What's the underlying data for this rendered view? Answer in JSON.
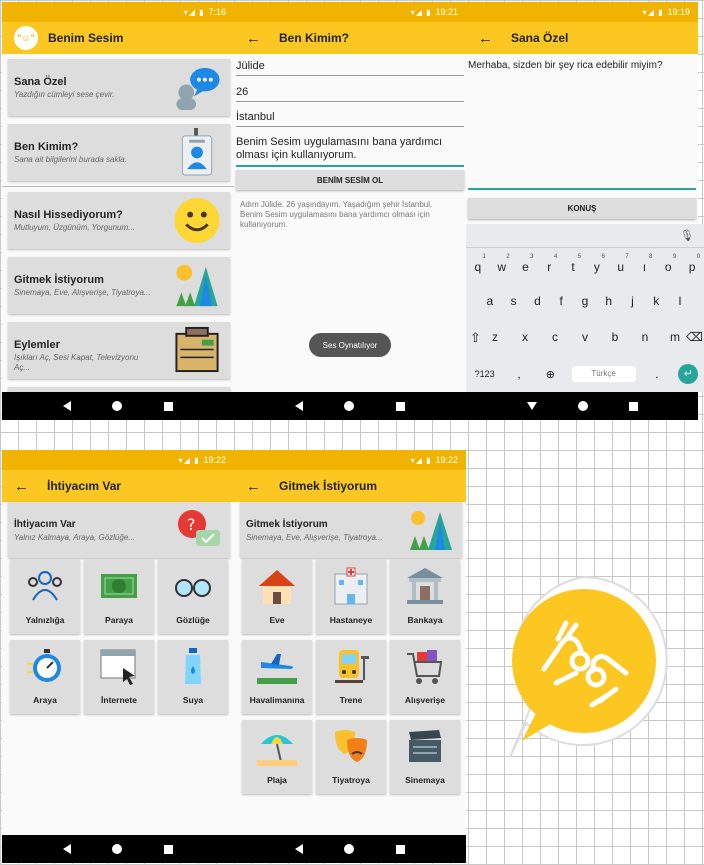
{
  "screen1": {
    "time": "7:16",
    "title": "Benim Sesim",
    "logo_text": "\"☺\"",
    "cards": [
      {
        "title": "Sana Özel",
        "subtitle": "Yazdığın cümleyi sese çevir.",
        "icon": "speech-bubble-icon"
      },
      {
        "title": "Ben Kimim?",
        "subtitle": "Sana ait bilgilerini burada sakla.",
        "icon": "id-badge-icon"
      },
      {
        "title": "Nasıl Hissediyorum?",
        "subtitle": "Mutluyum, Üzgünüm, Yorgunum...",
        "icon": "smiley-icon"
      },
      {
        "title": "Gitmek İstiyorum",
        "subtitle": "Sinemaya, Eve, Alışverişe, Tiyatroya...",
        "icon": "landscape-icon"
      },
      {
        "title": "Eylemler",
        "subtitle": "Işıkları Aç, Sesi Kapat, Televizyonu Aç...",
        "icon": "box-icon"
      }
    ]
  },
  "screen2": {
    "time": "19:21",
    "title": "Ben Kimim?",
    "name": "Jülide",
    "age": "26",
    "city": "İstanbul",
    "note": "Benim Sesim uygulamasını bana yardımcı olması için kullanıyorum.",
    "button": "BENİM SESİM OL",
    "summary": "Adım Jülide. 26 yaşındayım. Yaşadığım şehir İstanbul. Benim Sesim uygulamasını bana yardımcı olması için kullanıyorum.",
    "toast": "Ses Oynatılıyor"
  },
  "screen3": {
    "time": "19:19",
    "title": "Sana Özel",
    "text": "Merhaba, sizden bir şey rica edebilir miyim?",
    "button": "KONUŞ",
    "keyboard": {
      "row1": [
        [
          "q",
          "1"
        ],
        [
          "w",
          "2"
        ],
        [
          "e",
          "3"
        ],
        [
          "r",
          "4"
        ],
        [
          "t",
          "5"
        ],
        [
          "y",
          "6"
        ],
        [
          "u",
          "7"
        ],
        [
          "ı",
          "8"
        ],
        [
          "o",
          "9"
        ],
        [
          "p",
          "0"
        ]
      ],
      "row2": [
        "a",
        "s",
        "d",
        "f",
        "g",
        "h",
        "j",
        "k",
        "l"
      ],
      "row3": [
        "z",
        "x",
        "c",
        "v",
        "b",
        "n",
        "m"
      ],
      "symbols": "?123",
      "comma": ",",
      "space": "Türkçe",
      "period": "."
    }
  },
  "screen4": {
    "time": "19:22",
    "title": "İhtiyacım Var",
    "header_title": "İhtiyacım Var",
    "header_subtitle": "Yalnız Kalmaya, Araya, Gözlüğe...",
    "tiles": [
      "Yalnızlığa",
      "Paraya",
      "Gözlüğe",
      "Araya",
      "İnternete",
      "Suya"
    ]
  },
  "screen5": {
    "time": "19:22",
    "title": "Gitmek İstiyorum",
    "header_title": "Gitmek İstiyorum",
    "header_subtitle": "Sinemaya, Eve, Alışverişe, Tiyatroya...",
    "tiles": [
      "Eve",
      "Hastaneye",
      "Bankaya",
      "Havalimanına",
      "Trene",
      "Alışverişe",
      "Plaja",
      "Tiyatroya",
      "Sinemaya"
    ]
  },
  "colors": {
    "accent": "#fcc721",
    "status": "#f0b400",
    "teal": "#26a69a"
  }
}
